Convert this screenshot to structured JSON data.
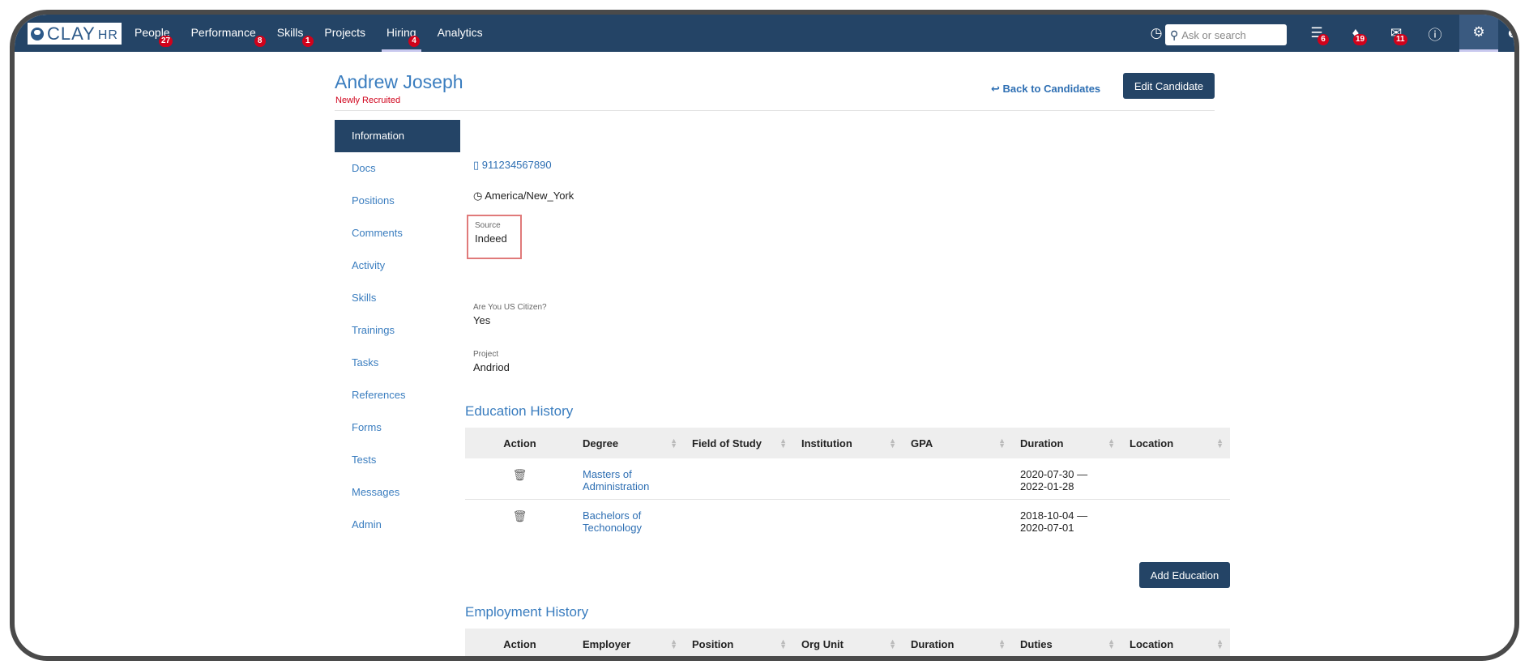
{
  "header": {
    "logo": "CLAY",
    "logo_suffix": "HR",
    "nav": [
      {
        "label": "People",
        "badge": "27"
      },
      {
        "label": "Performance",
        "badge": "8"
      },
      {
        "label": "Skills",
        "badge": "1"
      },
      {
        "label": "Projects",
        "badge": ""
      },
      {
        "label": "Hiring",
        "badge": "4"
      },
      {
        "label": "Analytics",
        "badge": ""
      }
    ],
    "search_placeholder": "Ask or search",
    "tools": {
      "layers_badge": "6",
      "bell_badge": "19",
      "mail_badge": "11"
    }
  },
  "candidate": {
    "name": "Andrew Joseph",
    "status": "Newly Recruited",
    "phone": "911234567890",
    "timezone": "America/New_York",
    "source_label": "Source",
    "source_value": "Indeed",
    "citizen_label": "Are You US Citizen?",
    "citizen_value": "Yes",
    "project_label": "Project",
    "project_value": "Andriod"
  },
  "actions": {
    "back": "Back to Candidates",
    "edit": "Edit Candidate",
    "add_education": "Add Education"
  },
  "sidenav": [
    "Information",
    "Docs",
    "Positions",
    "Comments",
    "Activity",
    "Skills",
    "Trainings",
    "Tasks",
    "References",
    "Forms",
    "Tests",
    "Messages",
    "Admin"
  ],
  "education": {
    "title": "Education History",
    "columns": [
      "Action",
      "Degree",
      "Field of Study",
      "Institution",
      "GPA",
      "Duration",
      "Location"
    ],
    "rows": [
      {
        "degree": "Masters of Administration",
        "field": "",
        "institution": "",
        "gpa": "",
        "duration": "2020-07-30 — 2022-01-28",
        "location": ""
      },
      {
        "degree": "Bachelors of Techonology",
        "field": "",
        "institution": "",
        "gpa": "",
        "duration": "2018-10-04 — 2020-07-01",
        "location": ""
      }
    ]
  },
  "employment": {
    "title": "Employment History",
    "columns": [
      "Action",
      "Employer",
      "Position",
      "Org Unit",
      "Duration",
      "Duties",
      "Location"
    ]
  },
  "colors": {
    "navy": "#244466",
    "link": "#3a7dbf",
    "badge": "#d0021b"
  }
}
